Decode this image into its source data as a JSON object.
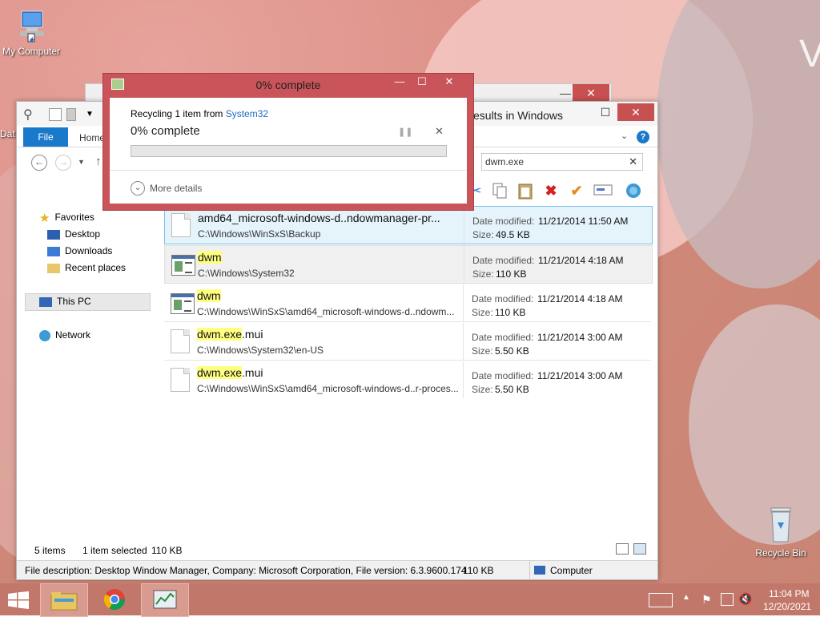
{
  "desktop": {
    "my_computer_label": "My Computer",
    "recycle_bin_label": "Recycle Bin",
    "partial_label": "Dat"
  },
  "explorer": {
    "title": "esults in Windows",
    "tabs": {
      "file": "File",
      "home": "Home"
    },
    "search_value": "dwm.exe",
    "nav": {
      "favorites": "Favorites",
      "desktop": "Desktop",
      "downloads": "Downloads",
      "recent": "Recent places",
      "this_pc": "This PC",
      "network": "Network"
    },
    "meta_labels": {
      "date": "Date modified:",
      "size": "Size:"
    },
    "files": [
      {
        "name": "amd64_microsoft-windows-d..ndowmanager-pr...",
        "name_hl": "",
        "name_rest": "",
        "path": "C:\\Windows\\WinSxS\\Backup",
        "date": "11/21/2014 11:50 AM",
        "size": "49.5 KB"
      },
      {
        "name": "",
        "name_hl": "dwm",
        "name_rest": "",
        "path": "C:\\Windows\\System32",
        "date": "11/21/2014 4:18 AM",
        "size": "110 KB"
      },
      {
        "name": "",
        "name_hl": "dwm",
        "name_rest": "",
        "path": "C:\\Windows\\WinSxS\\amd64_microsoft-windows-d..ndowm...",
        "date": "11/21/2014 4:18 AM",
        "size": "110 KB"
      },
      {
        "name": "",
        "name_hl": "dwm.exe",
        "name_rest": ".mui",
        "path": "C:\\Windows\\System32\\en-US",
        "date": "11/21/2014 3:00 AM",
        "size": "5.50 KB"
      },
      {
        "name": "",
        "name_hl": "dwm.exe",
        "name_rest": ".mui",
        "path": "C:\\Windows\\WinSxS\\amd64_microsoft-windows-d..r-proces...",
        "date": "11/21/2014 3:00 AM",
        "size": "5.50 KB"
      }
    ],
    "status": {
      "count": "5 items",
      "selected": "1 item selected",
      "selected_size": "110 KB"
    },
    "details": {
      "description": "File description: Desktop Window Manager, Company: Microsoft Corporation, File version: 6.3.9600.174",
      "size": "110 KB",
      "location": "Computer"
    }
  },
  "dialog": {
    "title": "0% complete",
    "recycling_prefix": "Recycling 1 item from",
    "recycling_link": "System32",
    "percent": "0% complete",
    "progress": 0,
    "more_details": "More details"
  },
  "taskbar": {
    "time": "11:04 PM",
    "date": "12/20/2021"
  }
}
